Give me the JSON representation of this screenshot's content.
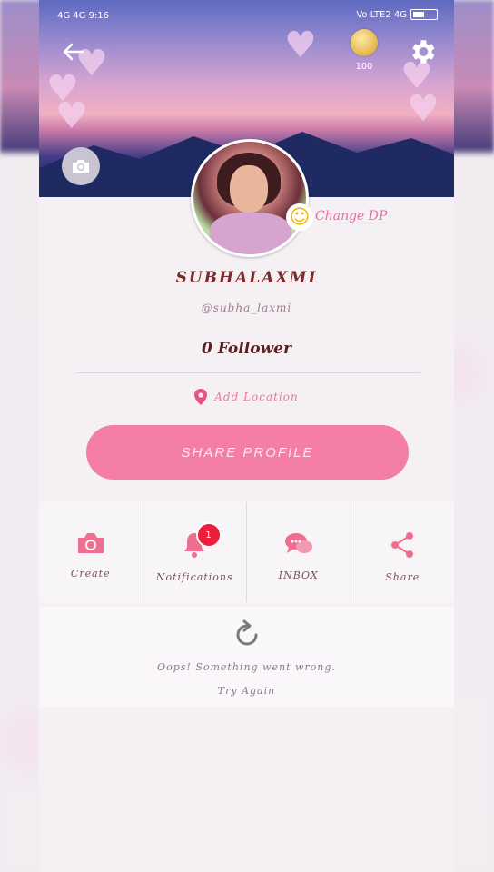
{
  "status_bar": {
    "left": "4G 4G 9:16",
    "right": "Vo LTE2 4G"
  },
  "header": {
    "coins": "100"
  },
  "profile": {
    "change_dp": "Change DP",
    "name": "SUBHALAXMI",
    "username": "@subha_laxmi",
    "followers": "0 Follower",
    "location": "Add Location",
    "share_button": "SHARE PROFILE"
  },
  "actions": [
    {
      "label": "Create",
      "icon": "camera-icon"
    },
    {
      "label": "Notifications",
      "icon": "bell-icon",
      "badge": "1"
    },
    {
      "label": "INBOX",
      "icon": "chat-icon"
    },
    {
      "label": "Share",
      "icon": "share-icon"
    }
  ],
  "error": {
    "message": "Oops! Something went wrong.",
    "retry": "Try Again"
  },
  "colors": {
    "accent": "#f57ea6",
    "badge": "#ec1e38"
  }
}
